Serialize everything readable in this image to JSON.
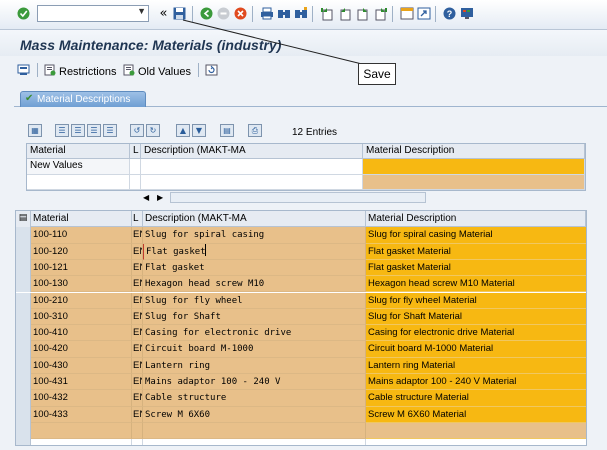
{
  "systembar": {
    "icons": [
      "enter-icon",
      "back-icon",
      "exit-icon",
      "cancel-icon",
      "print-icon",
      "find-icon",
      "find-next-icon",
      "first-page-icon",
      "previous-page-icon",
      "next-page-icon",
      "last-page-icon",
      "new-session-icon",
      "shortcut-icon",
      "help-icon",
      "customize-icon"
    ]
  },
  "tooltip": {
    "text": "Save"
  },
  "title": "Mass Maintenance: Materials (industry)",
  "apptoolbar": {
    "restrictions": "Restrictions",
    "old_values": "Old Values"
  },
  "tab": {
    "label": "Material Descriptions"
  },
  "entries": "12 Entries",
  "upper_grid": {
    "headers": [
      "Material",
      "L",
      "Description (MAKT-MA",
      "Material Description"
    ],
    "row_label": "New Values"
  },
  "lower_grid": {
    "headers": [
      "Material",
      "L",
      "Description (MAKT-MA",
      "Material Description"
    ],
    "rows": [
      {
        "material": "100-110",
        "lang": "EN",
        "description": "Slug for spiral casing",
        "material_description": "Slug for spiral casing Material"
      },
      {
        "material": "100-120",
        "lang": "EN",
        "description": "Flat gasket",
        "material_description": "Flat gasket Material"
      },
      {
        "material": "100-121",
        "lang": "EN",
        "description": "Flat gasket",
        "material_description": "Flat gasket Material"
      },
      {
        "material": "100-130",
        "lang": "EN",
        "description": "Hexagon head screw M10",
        "material_description": "Hexagon head screw M10 Material"
      },
      {
        "material": "100-210",
        "lang": "EN",
        "description": "Slug for fly wheel",
        "material_description": "Slug for fly wheel Material"
      },
      {
        "material": "100-310",
        "lang": "EN",
        "description": "Slug for Shaft",
        "material_description": "Slug for Shaft Material"
      },
      {
        "material": "100-410",
        "lang": "EN",
        "description": "Casing for electronic drive",
        "material_description": "Casing for electronic drive Material"
      },
      {
        "material": "100-420",
        "lang": "EN",
        "description": "Circuit board M-1000",
        "material_description": "Circuit board M-1000 Material"
      },
      {
        "material": "100-430",
        "lang": "EN",
        "description": "Lantern ring",
        "material_description": "Lantern ring Material"
      },
      {
        "material": "100-431",
        "lang": "EN",
        "description": "Mains adaptor 100 - 240 V",
        "material_description": "Mains adaptor 100 - 240 V Material"
      },
      {
        "material": "100-432",
        "lang": "EN",
        "description": "Cable structure",
        "material_description": "Cable structure Material"
      },
      {
        "material": "100-433",
        "lang": "EN",
        "description": "Screw M 6X60",
        "material_description": "Screw M 6X60 Material"
      }
    ]
  },
  "colors": {
    "editable_cell": "#f7b812",
    "readonly_cell": "#e8c08a",
    "title_text": "#1f3552"
  }
}
